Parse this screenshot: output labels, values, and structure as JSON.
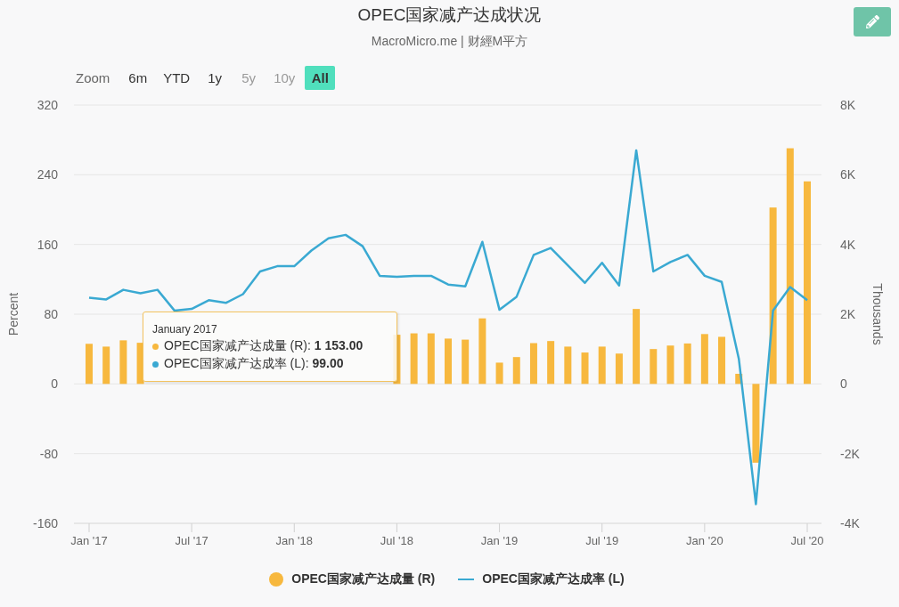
{
  "header": {
    "title": "OPEC国家减产达成状况",
    "subtitle": "MacroMicro.me | 财經M平方"
  },
  "range_selector": {
    "label": "Zoom",
    "buttons": [
      {
        "label": "6m",
        "selected": false,
        "disabled": false
      },
      {
        "label": "YTD",
        "selected": false,
        "disabled": false
      },
      {
        "label": "1y",
        "selected": false,
        "disabled": false
      },
      {
        "label": "5y",
        "selected": false,
        "disabled": true
      },
      {
        "label": "10y",
        "selected": false,
        "disabled": true
      },
      {
        "label": "All",
        "selected": true,
        "disabled": false
      }
    ]
  },
  "chart": {
    "tooltip": {
      "title": "January 2017",
      "rows": [
        {
          "text": "OPEC国家减产达成量 (R): **1 153.00**",
          "color": "#f7b83e"
        },
        {
          "text": "OPEC国家减产达成率 (L): **99.00**",
          "color": "#3aa9d2"
        }
      ]
    },
    "chart_data": {
      "type": "bar",
      "ylabel": "Percent",
      "y2label": "Thousands",
      "ylim": [
        -160,
        320
      ],
      "y2lim": [
        -4000,
        8000
      ],
      "grid": true,
      "categories": [
        "Jan '17",
        null,
        null,
        null,
        null,
        null,
        "Jul '17",
        null,
        null,
        null,
        null,
        null,
        "Jan '18",
        null,
        null,
        null,
        null,
        null,
        "Jul '18",
        null,
        null,
        null,
        null,
        null,
        "Jan '19",
        null,
        null,
        null,
        null,
        null,
        "Jul '19",
        null,
        null,
        null,
        null,
        null,
        "Jan '20",
        null,
        null,
        null,
        null,
        null,
        "Jul '20"
      ],
      "yticks": [
        -160,
        -80,
        0,
        80,
        160,
        240,
        320
      ],
      "y2ticks": [
        {
          "value": -4000,
          "label": "-4K"
        },
        {
          "value": -2000,
          "label": "-2K"
        },
        {
          "value": 0,
          "label": "0"
        },
        {
          "value": 2000,
          "label": "2K"
        },
        {
          "value": 4000,
          "label": "4K"
        },
        {
          "value": 6000,
          "label": "6K"
        },
        {
          "value": 8000,
          "label": "8K"
        }
      ],
      "series": [
        {
          "name": "OPEC国家减产达成量 (R)",
          "color": "#f7b83e",
          "axis": "y2",
          "values": [
            1150,
            1070,
            1250,
            1180,
            null,
            null,
            null,
            null,
            null,
            null,
            null,
            null,
            null,
            null,
            null,
            null,
            null,
            null,
            1410,
            1450,
            1450,
            1300,
            1270,
            1880,
            610,
            770,
            1170,
            1230,
            1070,
            900,
            1070,
            870,
            2150,
            1000,
            1100,
            1160,
            1430,
            1350,
            290,
            -2260,
            5060,
            6760,
            5810
          ]
        },
        {
          "name": "OPEC国家减产达成率 (L)",
          "color": "#3aa9d2",
          "type": "line",
          "values": [
            99,
            97,
            108,
            104,
            108,
            84,
            86,
            96,
            93,
            103,
            129,
            135,
            135,
            153,
            167,
            171,
            158,
            124,
            123,
            124,
            124,
            114,
            112,
            163,
            85,
            100,
            148,
            156,
            136,
            116,
            139,
            113,
            268,
            129,
            140,
            148,
            124,
            117,
            29,
            -138,
            84,
            111,
            96
          ]
        }
      ]
    }
  }
}
